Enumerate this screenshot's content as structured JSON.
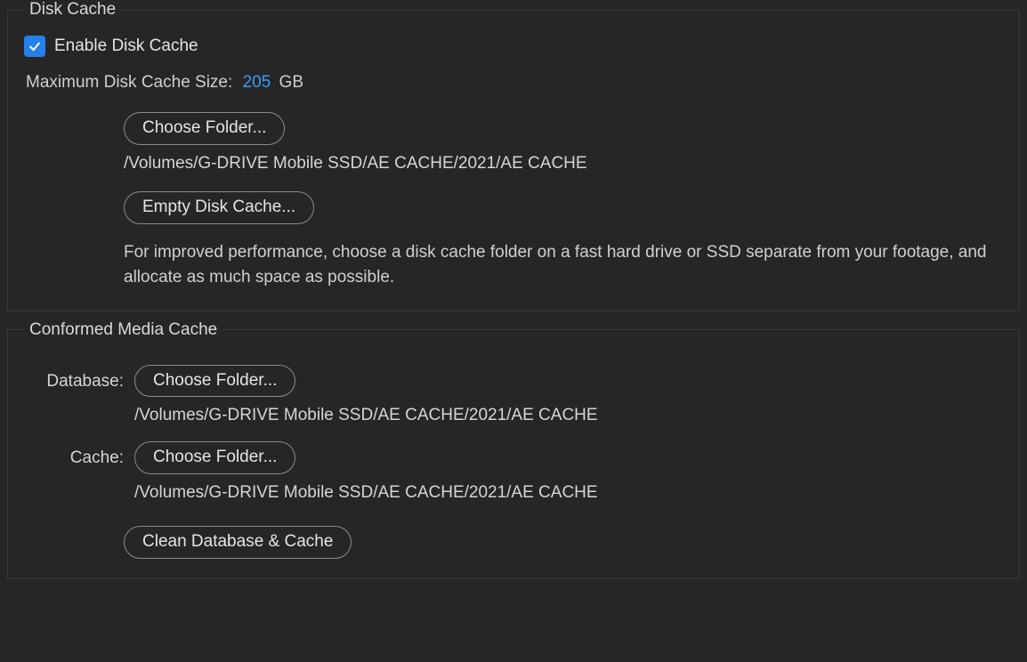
{
  "diskCache": {
    "legend": "Disk Cache",
    "enableLabel": "Enable Disk Cache",
    "enabled": true,
    "maxSizeLabel": "Maximum Disk Cache Size:",
    "maxSizeValue": "205",
    "maxSizeUnit": "GB",
    "chooseFolderLabel": "Choose Folder...",
    "folderPath": "/Volumes/G-DRIVE Mobile SSD/AE CACHE/2021/AE CACHE",
    "emptyCacheLabel": "Empty Disk Cache...",
    "hint": "For improved performance, choose a disk cache folder on a fast hard drive or SSD separate from your footage, and allocate as much space as possible."
  },
  "conformed": {
    "legend": "Conformed Media Cache",
    "databaseLabel": "Database:",
    "database": {
      "chooseFolderLabel": "Choose Folder...",
      "path": "/Volumes/G-DRIVE Mobile SSD/AE CACHE/2021/AE CACHE"
    },
    "cacheLabel": "Cache:",
    "cache": {
      "chooseFolderLabel": "Choose Folder...",
      "path": "/Volumes/G-DRIVE Mobile SSD/AE CACHE/2021/AE CACHE"
    },
    "cleanLabel": "Clean Database & Cache"
  }
}
